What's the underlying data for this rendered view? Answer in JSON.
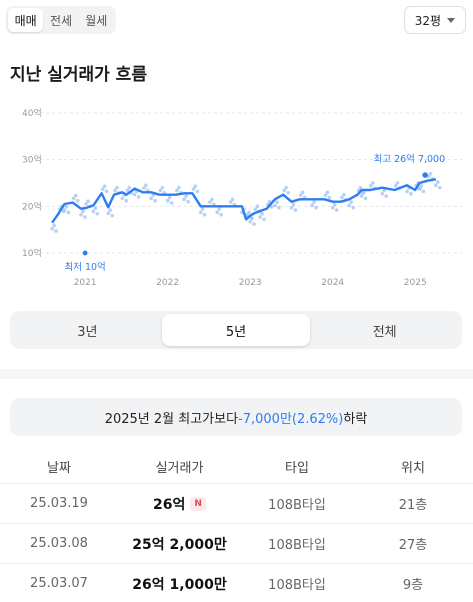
{
  "deal_tabs": [
    {
      "label": "매매",
      "active": true
    },
    {
      "label": "전세",
      "active": false
    },
    {
      "label": "월세",
      "active": false
    }
  ],
  "area_select": {
    "value": "32평"
  },
  "section_title": "지난 실거래가 흐름",
  "chart_data": {
    "type": "line",
    "x_ticks": [
      "2021",
      "2022",
      "2023",
      "2024",
      "2025"
    ],
    "y_ticks": [
      "10억",
      "20억",
      "30억",
      "40억"
    ],
    "ylim": [
      10,
      40
    ],
    "xlim": [
      2020.55,
      2025.3
    ],
    "grid": true,
    "series": [
      {
        "values_x": [
          2020.6,
          2020.68,
          2020.75,
          2020.85,
          2020.95,
          2021.0,
          2021.1,
          2021.2,
          2021.28,
          2021.35,
          2021.45,
          2021.5,
          2021.6,
          2021.7,
          2021.8,
          2021.9,
          2022.0,
          2022.1,
          2022.2,
          2022.3,
          2022.4,
          2022.5,
          2022.6,
          2022.75,
          2022.9,
          2022.95,
          2023.0,
          2023.05,
          2023.12,
          2023.2,
          2023.3,
          2023.4,
          2023.5,
          2023.6,
          2023.75,
          2023.9,
          2024.0,
          2024.1,
          2024.2,
          2024.3,
          2024.35,
          2024.45,
          2024.6,
          2024.75,
          2024.9,
          2025.0,
          2025.05,
          2025.15,
          2025.25
        ],
        "values_y": [
          16.5,
          18.5,
          20.5,
          20.8,
          19.5,
          19.6,
          20.2,
          22.8,
          19.8,
          22.5,
          23.0,
          22.5,
          23.8,
          23.0,
          23.0,
          22.5,
          22.5,
          22.5,
          22.8,
          22.8,
          20.0,
          20.0,
          20.0,
          20.0,
          20.0,
          17.2,
          18.0,
          18.5,
          19.0,
          19.5,
          21.5,
          22.5,
          21.0,
          21.5,
          21.5,
          21.5,
          21.0,
          21.0,
          21.5,
          22.5,
          23.5,
          23.5,
          24.0,
          23.5,
          24.5,
          23.5,
          25.0,
          25.5,
          25.8
        ]
      }
    ],
    "annotations": [
      {
        "label": "최고 26억 7,000",
        "x": 2025.12,
        "y": 26.7
      },
      {
        "label": "최저 10억",
        "x": 2021.0,
        "y": 10.0
      }
    ]
  },
  "period_tabs": [
    {
      "label": "3년",
      "active": false
    },
    {
      "label": "5년",
      "active": true
    },
    {
      "label": "전체",
      "active": false
    }
  ],
  "banner": {
    "prefix": "2025년 2월 최고가보다 ",
    "accent": "-7,000만(2.62%)",
    "suffix": " 하락"
  },
  "table": {
    "headers": [
      "날짜",
      "실거래가",
      "타입",
      "위치"
    ],
    "rows": [
      {
        "date": "25.03.19",
        "price": "26억",
        "new": "N",
        "type": "108B타입",
        "floor": "21층"
      },
      {
        "date": "25.03.08",
        "price": "25억 2,000만",
        "new": "",
        "type": "108B타입",
        "floor": "27층"
      },
      {
        "date": "25.03.07",
        "price": "26억 1,000만",
        "new": "",
        "type": "108B타입",
        "floor": "9층"
      }
    ]
  },
  "colors": {
    "accent": "#2e7df0",
    "dot": "#a9c8f5"
  }
}
